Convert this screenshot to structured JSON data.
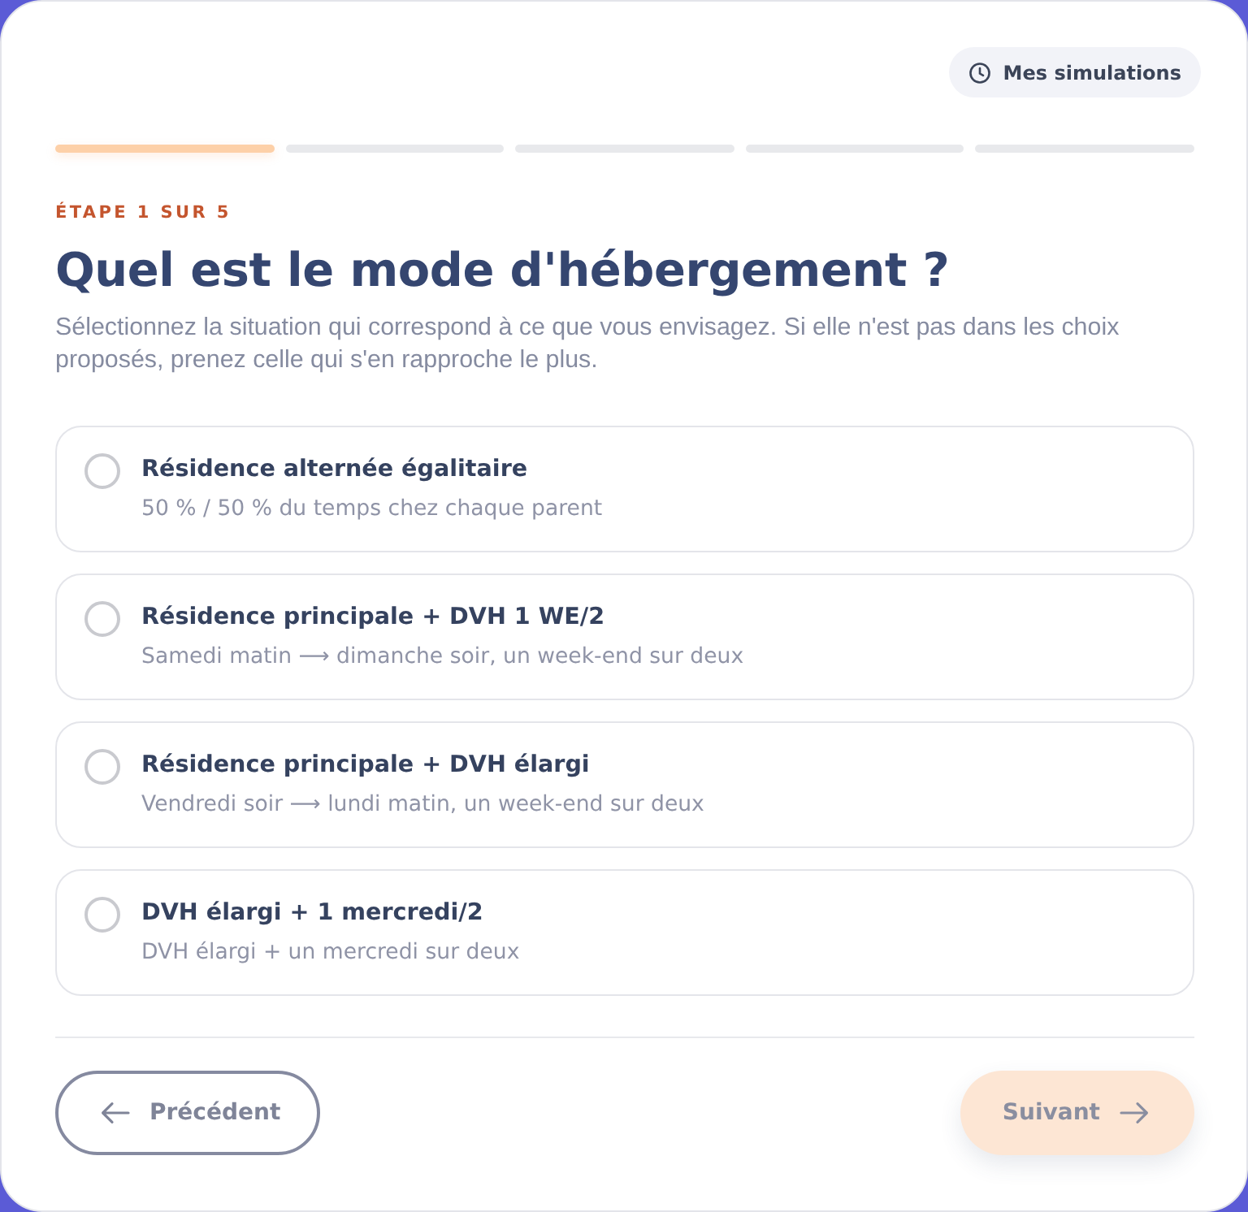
{
  "header": {
    "history_button": "Mes simulations"
  },
  "progress": {
    "steps": [
      {
        "done": true
      },
      {
        "done": false
      },
      {
        "done": false
      },
      {
        "done": false
      },
      {
        "done": false
      }
    ]
  },
  "step_label": "ÉTAPE 1 SUR 5",
  "title": "Quel est le mode d'hébergement ?",
  "description": "Sélectionnez la situation qui correspond à ce que vous envisagez. Si elle n'est pas dans les choix proposés, prenez celle qui s'en rapproche le plus.",
  "options": [
    {
      "title": "Résidence alternée égalitaire",
      "subtitle": "50 % / 50 % du temps chez chaque parent",
      "selected": false
    },
    {
      "title": "Résidence principale + DVH 1 WE/2",
      "subtitle": "Samedi matin ⟶ dimanche soir, un week-end sur deux",
      "selected": false
    },
    {
      "title": "Résidence principale + DVH élargi",
      "subtitle": "Vendredi soir ⟶ lundi matin, un week-end sur deux",
      "selected": false
    },
    {
      "title": "DVH élargi + 1 mercredi/2",
      "subtitle": "DVH élargi + un mercredi sur deux",
      "selected": false
    }
  ],
  "footer": {
    "back_button": {
      "label": "Précédent",
      "disabled": false
    },
    "next_button": {
      "label": "Suivant",
      "disabled": true
    }
  }
}
